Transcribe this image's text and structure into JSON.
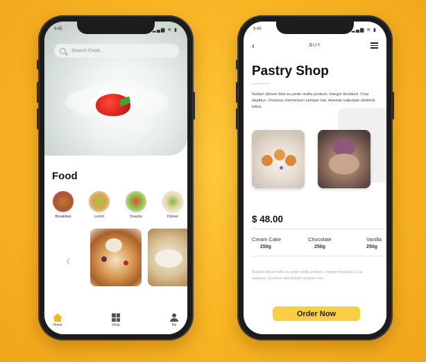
{
  "left_phone": {
    "status": {
      "time": "9:45",
      "icons": "▂▄▆ ≋ ▮"
    },
    "search": {
      "placeholder": "Search Food..."
    },
    "section_title": "Food",
    "categories": [
      {
        "label": "Breakfast"
      },
      {
        "label": "Lunch"
      },
      {
        "label": "Snacks"
      },
      {
        "label": "Dinner"
      }
    ],
    "carousel_prev": "‹",
    "tabs": [
      {
        "label": "Home"
      },
      {
        "label": "Shop"
      },
      {
        "label": "My"
      }
    ]
  },
  "right_phone": {
    "status": {
      "time": "9:45",
      "icons": "▂▄▆ ≋ ▮"
    },
    "header": {
      "back": "‹",
      "title": "BUY"
    },
    "shop_title": "Pastry Shop",
    "description": "Nullam dictum felis eu pede mollis pretium. Integer tincidunt. Cras dapibus. Vivamus elementum semper nisi. Aenean vulputate eleifend tellus.",
    "price": "$ 48.00",
    "variants": [
      {
        "name": "Cream Cake",
        "weight": "250g"
      },
      {
        "name": "Chocolate",
        "weight": "250g"
      },
      {
        "name": "Vanilla",
        "weight": "250g"
      }
    ],
    "footer_text": "Nullam dictum felis eu pede mollis pretium. Integer tincidunt. Cras dapibus. Vivamus elementum semper nisi.",
    "order_button": "Order Now"
  },
  "colors": {
    "background": "#f9b524",
    "accent_yellow": "#f8cf43",
    "home_icon": "#f5b91f"
  }
}
